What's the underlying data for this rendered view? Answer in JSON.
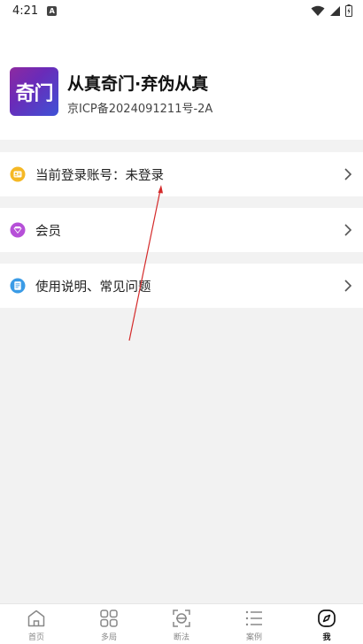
{
  "status_bar": {
    "time": "4:21",
    "notification_icon": "a-icon",
    "icons": [
      "wifi-icon",
      "signal-icon",
      "battery-icon"
    ]
  },
  "app": {
    "logo_text": "奇门",
    "title": "从真奇门·弃伪从真",
    "icp": "京ICP备2024091211号-2A",
    "logo_gradient": [
      "#8e2aa0",
      "#3e52d6"
    ]
  },
  "menu": [
    {
      "label": "当前登录账号：未登录",
      "icon": "account-icon",
      "icon_color": "#f5b825"
    },
    {
      "label": "会员",
      "icon": "vip-diamond-icon",
      "icon_color": "#b650d8"
    },
    {
      "label": "使用说明、常见问题",
      "icon": "document-icon",
      "icon_color": "#3a9be6"
    }
  ],
  "tabs": [
    {
      "label": "首页",
      "icon": "home-icon",
      "active": false
    },
    {
      "label": "多局",
      "icon": "grid-icon",
      "active": false
    },
    {
      "label": "断法",
      "icon": "scan-icon",
      "active": false
    },
    {
      "label": "案例",
      "icon": "list-icon",
      "active": false
    },
    {
      "label": "我",
      "icon": "compass-icon",
      "active": true
    }
  ],
  "colors": {
    "annotation_arrow": "#d42a2a",
    "background": "#f2f2f2"
  }
}
